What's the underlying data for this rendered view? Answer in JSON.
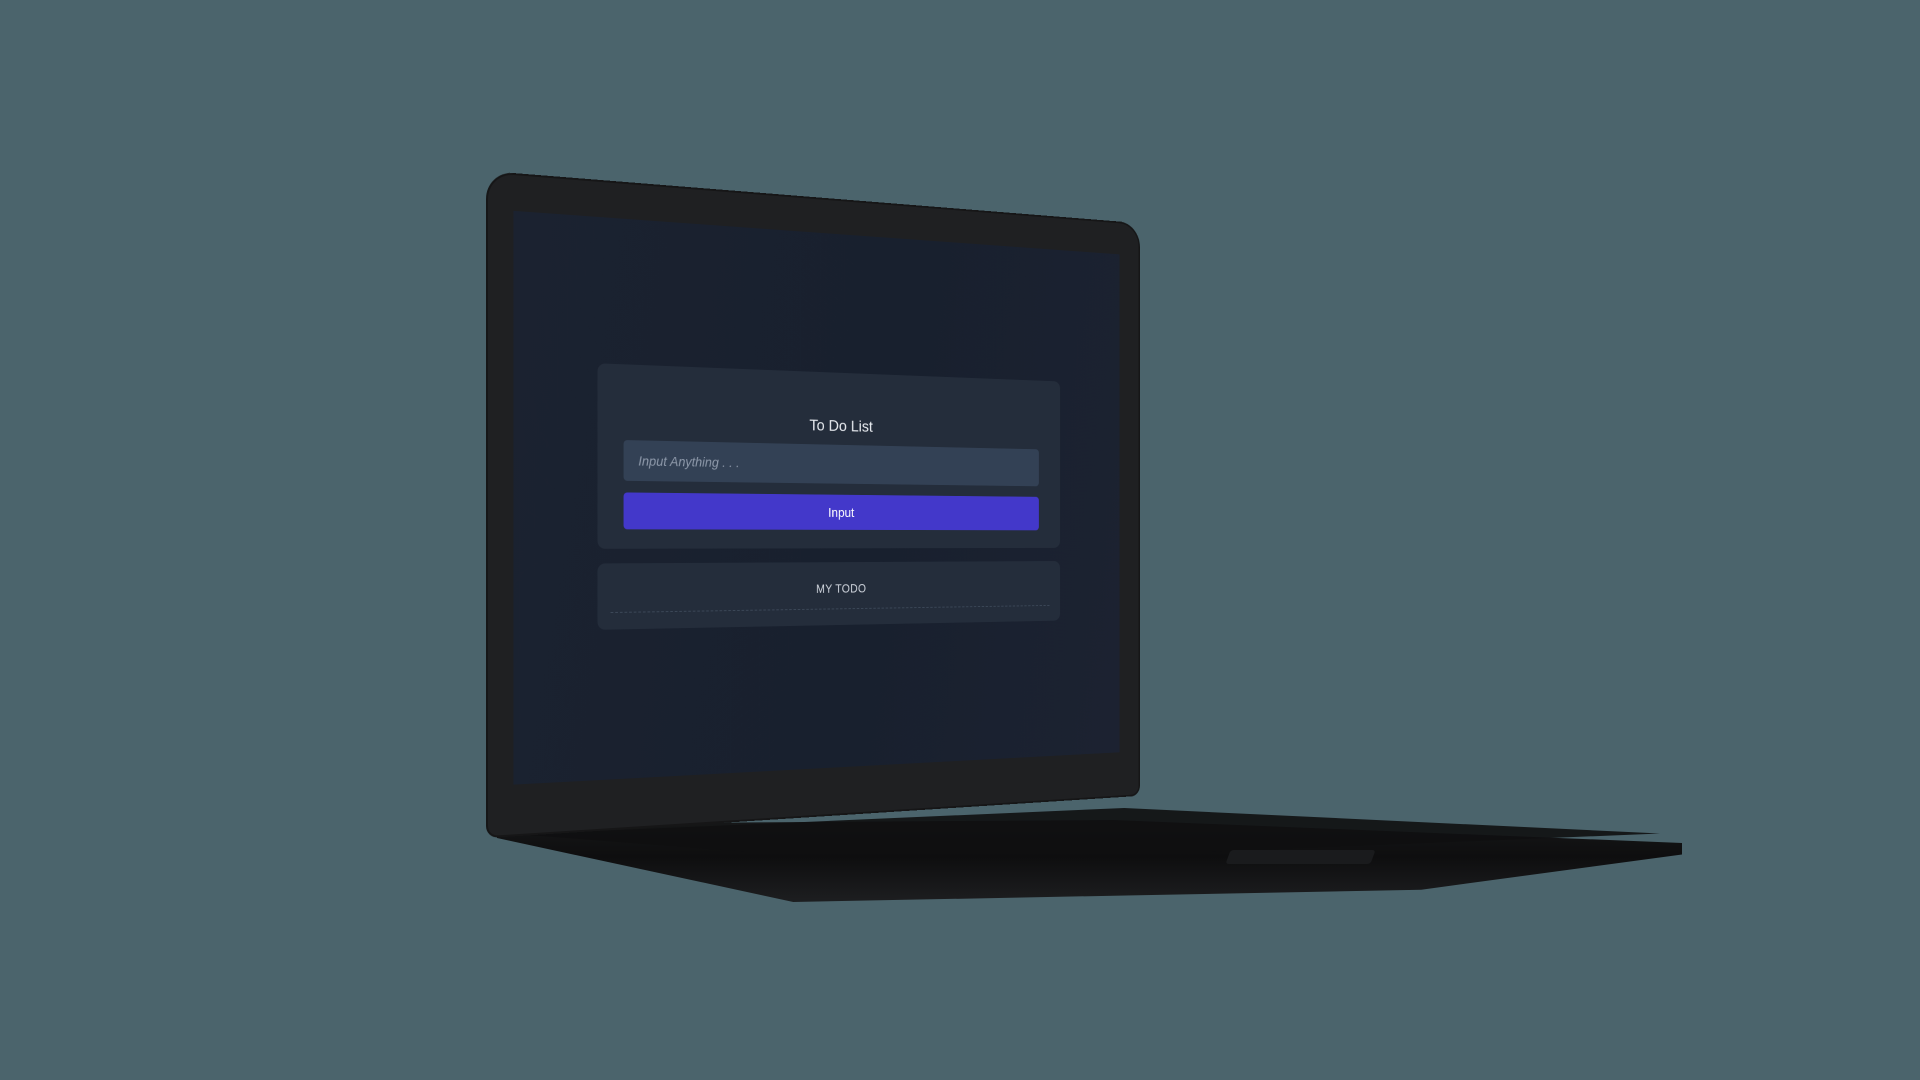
{
  "app": {
    "title": "To Do List",
    "input": {
      "placeholder": "Input Anything . . .",
      "value": ""
    },
    "submit_label": "Input",
    "list_title": "MY TODO",
    "items": []
  },
  "colors": {
    "background": "#4b646c",
    "screen": "#1b2230",
    "card": "#242d3b",
    "input": "#334155",
    "button": "#4338ca",
    "laptop_body": "#1f2022"
  }
}
